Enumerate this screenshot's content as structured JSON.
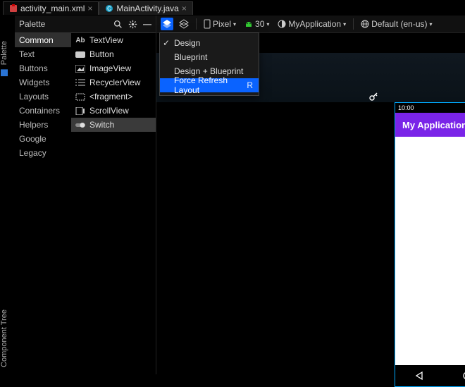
{
  "tabs": [
    {
      "label": "activity_main.xml"
    },
    {
      "label": "MainActivity.java"
    }
  ],
  "palette": {
    "title": "Palette",
    "categories": [
      "Common",
      "Text",
      "Buttons",
      "Widgets",
      "Layouts",
      "Containers",
      "Helpers",
      "Google",
      "Legacy"
    ],
    "widgets": [
      {
        "label": "TextView",
        "icon": "Ab"
      },
      {
        "label": "Button",
        "icon": "btn"
      },
      {
        "label": "ImageView",
        "icon": "img"
      },
      {
        "label": "RecyclerView",
        "icon": "list"
      },
      {
        "label": "<fragment>",
        "icon": "frag"
      },
      {
        "label": "ScrollView",
        "icon": "scroll"
      },
      {
        "label": "Switch",
        "icon": "switch"
      }
    ]
  },
  "toolbar": {
    "device_label": "Pixel",
    "api_label": "30",
    "app_label": "MyApplication",
    "locale_label": "Default (en-us)"
  },
  "view_menu": {
    "items": [
      {
        "label": "Design",
        "checked": true
      },
      {
        "label": "Blueprint",
        "checked": false
      },
      {
        "label": "Design + Blueprint",
        "checked": false
      },
      {
        "label": "Force Refresh Layout",
        "shortcut": "R",
        "hl": true
      }
    ]
  },
  "preview": {
    "clock": "10:00",
    "title": "My Application"
  },
  "side_tabs": {
    "palette": "Palette",
    "tree": "Component Tree"
  }
}
